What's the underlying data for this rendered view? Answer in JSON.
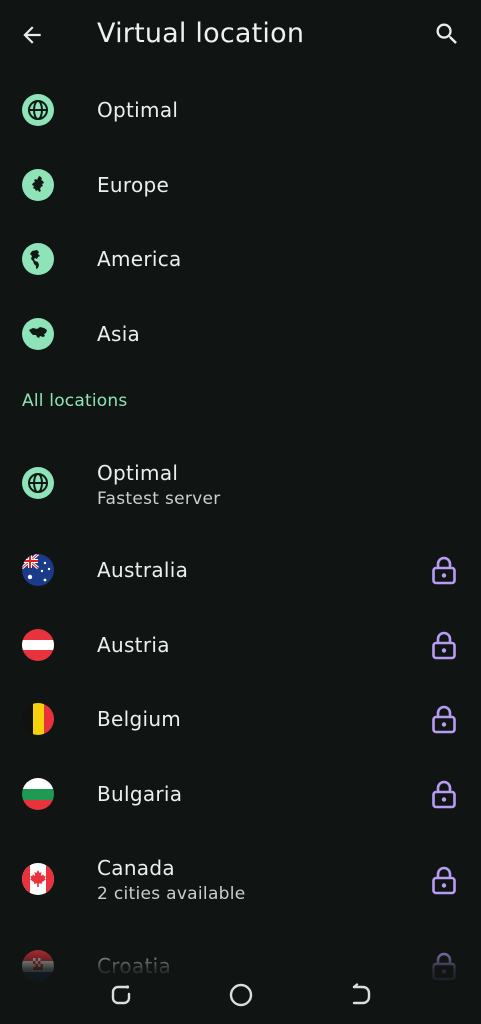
{
  "appbar": {
    "title": "Virtual location"
  },
  "regions": [
    {
      "label": "Optimal",
      "icon": "globe-icon"
    },
    {
      "label": "Europe",
      "icon": "europe-map-icon"
    },
    {
      "label": "America",
      "icon": "americas-map-icon"
    },
    {
      "label": "Asia",
      "icon": "asia-map-icon"
    }
  ],
  "section": {
    "all_locations": "All locations"
  },
  "locations": [
    {
      "label": "Optimal",
      "sub": "Fastest server",
      "icon": "globe-icon",
      "locked": false
    },
    {
      "label": "Australia",
      "sub": "",
      "icon": "flag-australia-icon",
      "locked": true
    },
    {
      "label": "Austria",
      "sub": "",
      "icon": "flag-austria-icon",
      "locked": true
    },
    {
      "label": "Belgium",
      "sub": "",
      "icon": "flag-belgium-icon",
      "locked": true
    },
    {
      "label": "Bulgaria",
      "sub": "",
      "icon": "flag-bulgaria-icon",
      "locked": true
    },
    {
      "label": "Canada",
      "sub": "2 cities available",
      "icon": "flag-canada-icon",
      "locked": true
    },
    {
      "label": "Croatia",
      "sub": "",
      "icon": "flag-croatia-icon",
      "locked": true
    }
  ],
  "colors": {
    "background": "#101513",
    "accent_green": "#8ee3b8",
    "lock_purple": "#b79cf4",
    "text": "#ecefed"
  },
  "navbar": {
    "icons": [
      "recent-apps-icon",
      "home-icon",
      "back-nav-icon"
    ]
  }
}
